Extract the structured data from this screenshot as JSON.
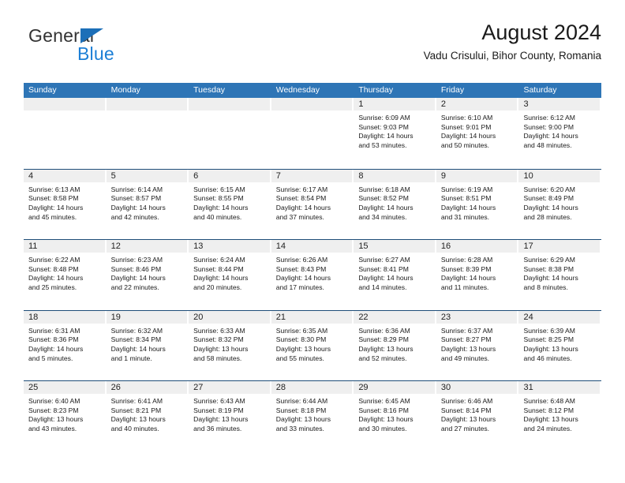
{
  "brand": {
    "name_part1": "General",
    "name_part2": "Blue",
    "triangle_color": "#1C6FB8",
    "blue_color": "#1C7FD6"
  },
  "header": {
    "title": "August 2024",
    "location": "Vadu Crisului, Bihor County, Romania"
  },
  "theme": {
    "header_bg": "#2E75B6",
    "header_text": "#FFFFFF",
    "row_divider": "#1F4E79",
    "daynum_band": "#EFEFEF",
    "cell_bg": "#FFFFFF",
    "body_text": "#1A1A1A"
  },
  "weekdays": [
    "Sunday",
    "Monday",
    "Tuesday",
    "Wednesday",
    "Thursday",
    "Friday",
    "Saturday"
  ],
  "labels": {
    "sunrise": "Sunrise:",
    "sunset": "Sunset:",
    "daylight": "Daylight:"
  },
  "weeks": [
    [
      {
        "day": "",
        "empty": true
      },
      {
        "day": "",
        "empty": true
      },
      {
        "day": "",
        "empty": true
      },
      {
        "day": "",
        "empty": true
      },
      {
        "day": "1",
        "sunrise": "Sunrise: 6:09 AM",
        "sunset": "Sunset: 9:03 PM",
        "daylight_l1": "Daylight: 14 hours",
        "daylight_l2": "and 53 minutes."
      },
      {
        "day": "2",
        "sunrise": "Sunrise: 6:10 AM",
        "sunset": "Sunset: 9:01 PM",
        "daylight_l1": "Daylight: 14 hours",
        "daylight_l2": "and 50 minutes."
      },
      {
        "day": "3",
        "sunrise": "Sunrise: 6:12 AM",
        "sunset": "Sunset: 9:00 PM",
        "daylight_l1": "Daylight: 14 hours",
        "daylight_l2": "and 48 minutes."
      }
    ],
    [
      {
        "day": "4",
        "sunrise": "Sunrise: 6:13 AM",
        "sunset": "Sunset: 8:58 PM",
        "daylight_l1": "Daylight: 14 hours",
        "daylight_l2": "and 45 minutes."
      },
      {
        "day": "5",
        "sunrise": "Sunrise: 6:14 AM",
        "sunset": "Sunset: 8:57 PM",
        "daylight_l1": "Daylight: 14 hours",
        "daylight_l2": "and 42 minutes."
      },
      {
        "day": "6",
        "sunrise": "Sunrise: 6:15 AM",
        "sunset": "Sunset: 8:55 PM",
        "daylight_l1": "Daylight: 14 hours",
        "daylight_l2": "and 40 minutes."
      },
      {
        "day": "7",
        "sunrise": "Sunrise: 6:17 AM",
        "sunset": "Sunset: 8:54 PM",
        "daylight_l1": "Daylight: 14 hours",
        "daylight_l2": "and 37 minutes."
      },
      {
        "day": "8",
        "sunrise": "Sunrise: 6:18 AM",
        "sunset": "Sunset: 8:52 PM",
        "daylight_l1": "Daylight: 14 hours",
        "daylight_l2": "and 34 minutes."
      },
      {
        "day": "9",
        "sunrise": "Sunrise: 6:19 AM",
        "sunset": "Sunset: 8:51 PM",
        "daylight_l1": "Daylight: 14 hours",
        "daylight_l2": "and 31 minutes."
      },
      {
        "day": "10",
        "sunrise": "Sunrise: 6:20 AM",
        "sunset": "Sunset: 8:49 PM",
        "daylight_l1": "Daylight: 14 hours",
        "daylight_l2": "and 28 minutes."
      }
    ],
    [
      {
        "day": "11",
        "sunrise": "Sunrise: 6:22 AM",
        "sunset": "Sunset: 8:48 PM",
        "daylight_l1": "Daylight: 14 hours",
        "daylight_l2": "and 25 minutes."
      },
      {
        "day": "12",
        "sunrise": "Sunrise: 6:23 AM",
        "sunset": "Sunset: 8:46 PM",
        "daylight_l1": "Daylight: 14 hours",
        "daylight_l2": "and 22 minutes."
      },
      {
        "day": "13",
        "sunrise": "Sunrise: 6:24 AM",
        "sunset": "Sunset: 8:44 PM",
        "daylight_l1": "Daylight: 14 hours",
        "daylight_l2": "and 20 minutes."
      },
      {
        "day": "14",
        "sunrise": "Sunrise: 6:26 AM",
        "sunset": "Sunset: 8:43 PM",
        "daylight_l1": "Daylight: 14 hours",
        "daylight_l2": "and 17 minutes."
      },
      {
        "day": "15",
        "sunrise": "Sunrise: 6:27 AM",
        "sunset": "Sunset: 8:41 PM",
        "daylight_l1": "Daylight: 14 hours",
        "daylight_l2": "and 14 minutes."
      },
      {
        "day": "16",
        "sunrise": "Sunrise: 6:28 AM",
        "sunset": "Sunset: 8:39 PM",
        "daylight_l1": "Daylight: 14 hours",
        "daylight_l2": "and 11 minutes."
      },
      {
        "day": "17",
        "sunrise": "Sunrise: 6:29 AM",
        "sunset": "Sunset: 8:38 PM",
        "daylight_l1": "Daylight: 14 hours",
        "daylight_l2": "and 8 minutes."
      }
    ],
    [
      {
        "day": "18",
        "sunrise": "Sunrise: 6:31 AM",
        "sunset": "Sunset: 8:36 PM",
        "daylight_l1": "Daylight: 14 hours",
        "daylight_l2": "and 5 minutes."
      },
      {
        "day": "19",
        "sunrise": "Sunrise: 6:32 AM",
        "sunset": "Sunset: 8:34 PM",
        "daylight_l1": "Daylight: 14 hours",
        "daylight_l2": "and 1 minute."
      },
      {
        "day": "20",
        "sunrise": "Sunrise: 6:33 AM",
        "sunset": "Sunset: 8:32 PM",
        "daylight_l1": "Daylight: 13 hours",
        "daylight_l2": "and 58 minutes."
      },
      {
        "day": "21",
        "sunrise": "Sunrise: 6:35 AM",
        "sunset": "Sunset: 8:30 PM",
        "daylight_l1": "Daylight: 13 hours",
        "daylight_l2": "and 55 minutes."
      },
      {
        "day": "22",
        "sunrise": "Sunrise: 6:36 AM",
        "sunset": "Sunset: 8:29 PM",
        "daylight_l1": "Daylight: 13 hours",
        "daylight_l2": "and 52 minutes."
      },
      {
        "day": "23",
        "sunrise": "Sunrise: 6:37 AM",
        "sunset": "Sunset: 8:27 PM",
        "daylight_l1": "Daylight: 13 hours",
        "daylight_l2": "and 49 minutes."
      },
      {
        "day": "24",
        "sunrise": "Sunrise: 6:39 AM",
        "sunset": "Sunset: 8:25 PM",
        "daylight_l1": "Daylight: 13 hours",
        "daylight_l2": "and 46 minutes."
      }
    ],
    [
      {
        "day": "25",
        "sunrise": "Sunrise: 6:40 AM",
        "sunset": "Sunset: 8:23 PM",
        "daylight_l1": "Daylight: 13 hours",
        "daylight_l2": "and 43 minutes."
      },
      {
        "day": "26",
        "sunrise": "Sunrise: 6:41 AM",
        "sunset": "Sunset: 8:21 PM",
        "daylight_l1": "Daylight: 13 hours",
        "daylight_l2": "and 40 minutes."
      },
      {
        "day": "27",
        "sunrise": "Sunrise: 6:43 AM",
        "sunset": "Sunset: 8:19 PM",
        "daylight_l1": "Daylight: 13 hours",
        "daylight_l2": "and 36 minutes."
      },
      {
        "day": "28",
        "sunrise": "Sunrise: 6:44 AM",
        "sunset": "Sunset: 8:18 PM",
        "daylight_l1": "Daylight: 13 hours",
        "daylight_l2": "and 33 minutes."
      },
      {
        "day": "29",
        "sunrise": "Sunrise: 6:45 AM",
        "sunset": "Sunset: 8:16 PM",
        "daylight_l1": "Daylight: 13 hours",
        "daylight_l2": "and 30 minutes."
      },
      {
        "day": "30",
        "sunrise": "Sunrise: 6:46 AM",
        "sunset": "Sunset: 8:14 PM",
        "daylight_l1": "Daylight: 13 hours",
        "daylight_l2": "and 27 minutes."
      },
      {
        "day": "31",
        "sunrise": "Sunrise: 6:48 AM",
        "sunset": "Sunset: 8:12 PM",
        "daylight_l1": "Daylight: 13 hours",
        "daylight_l2": "and 24 minutes."
      }
    ]
  ]
}
